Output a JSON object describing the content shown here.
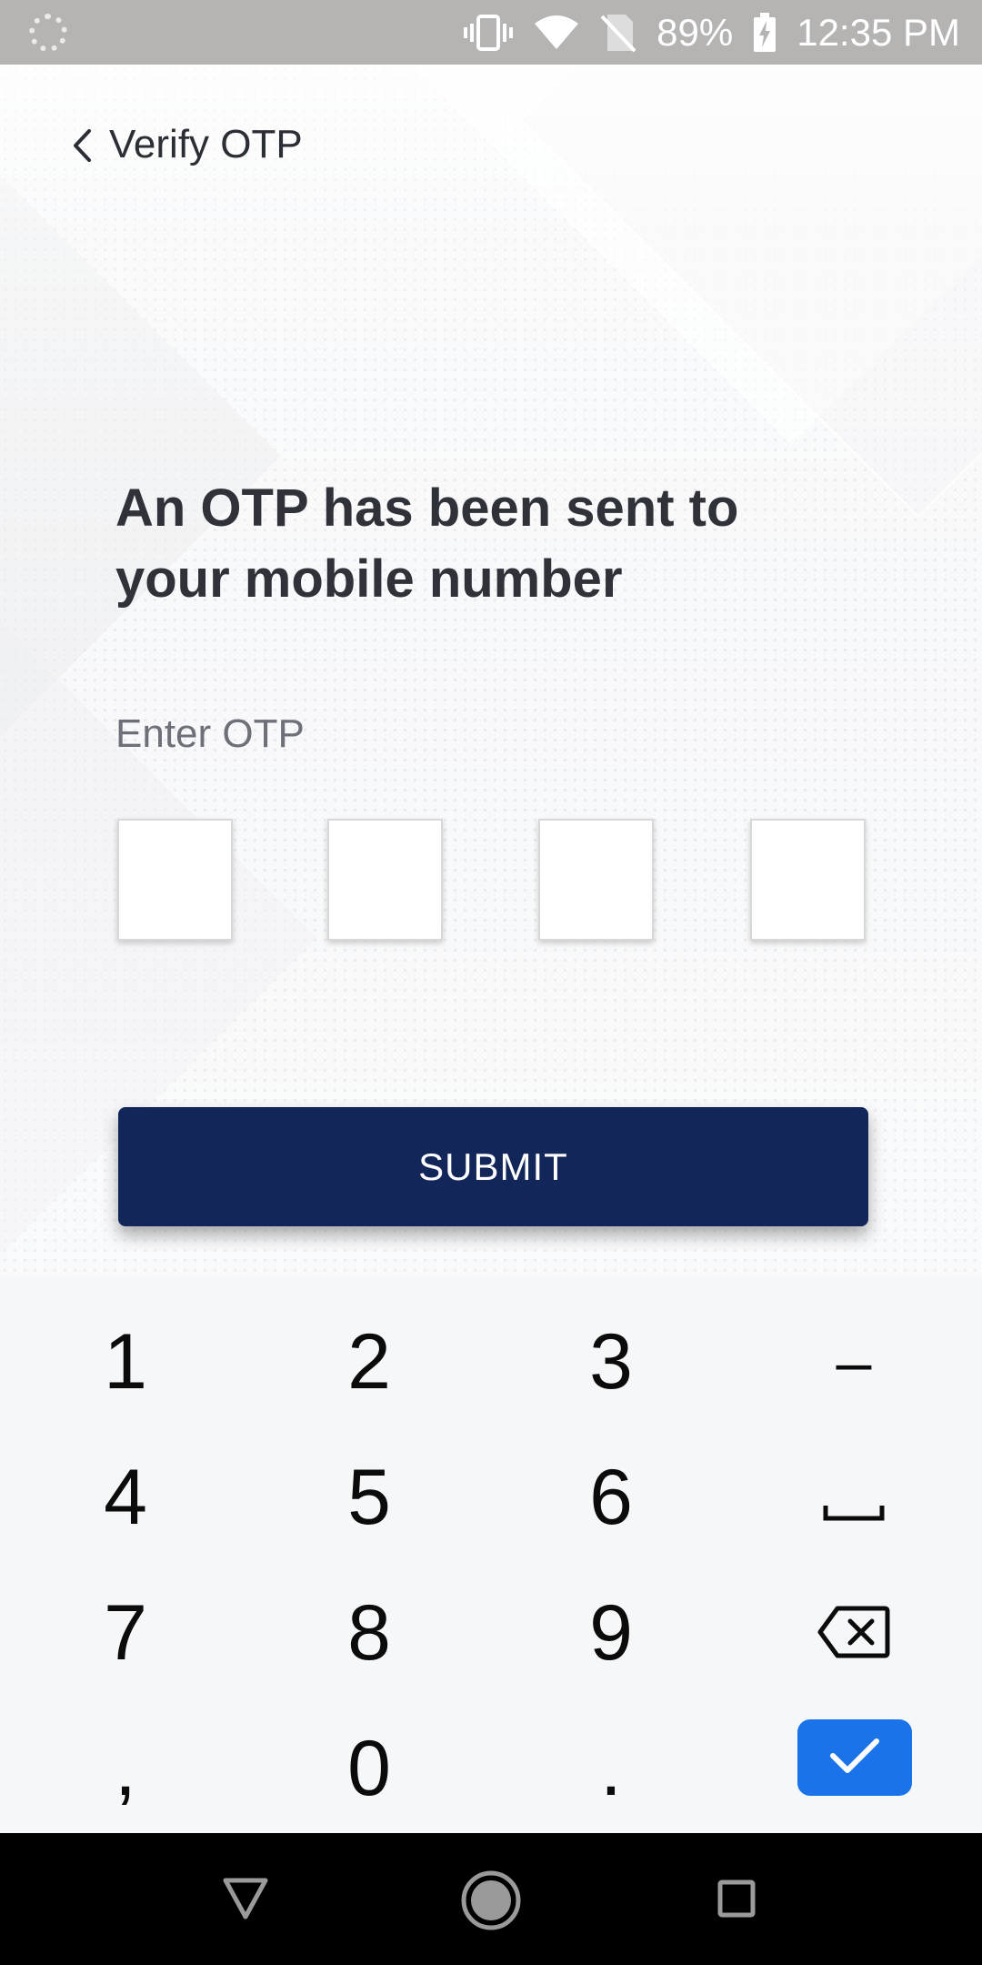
{
  "status_bar": {
    "battery": "89%",
    "time": "12:35 PM",
    "icons": [
      "loading-icon",
      "vibrate-icon",
      "wifi-icon",
      "no-sim-icon",
      "battery-charging-icon"
    ]
  },
  "header": {
    "title": "Verify OTP",
    "back_icon": "chevron-left-icon"
  },
  "content": {
    "headline_line1": "An OTP has been sent to",
    "headline_line2": "your mobile number",
    "otp_label": "Enter OTP",
    "otp_boxes": [
      "",
      "",
      "",
      ""
    ],
    "submit_label": "SUBMIT"
  },
  "keypad": {
    "rows": [
      [
        "1",
        "2",
        "3",
        "–"
      ],
      [
        "4",
        "5",
        "6",
        "space"
      ],
      [
        "7",
        "8",
        "9",
        "backspace"
      ],
      [
        ",",
        "0",
        ".",
        "done"
      ]
    ],
    "done_color": "#1a73e8"
  },
  "colors": {
    "primary": "#12265a",
    "status_bar": "#b6b3b3",
    "nav_bar": "#000000"
  }
}
